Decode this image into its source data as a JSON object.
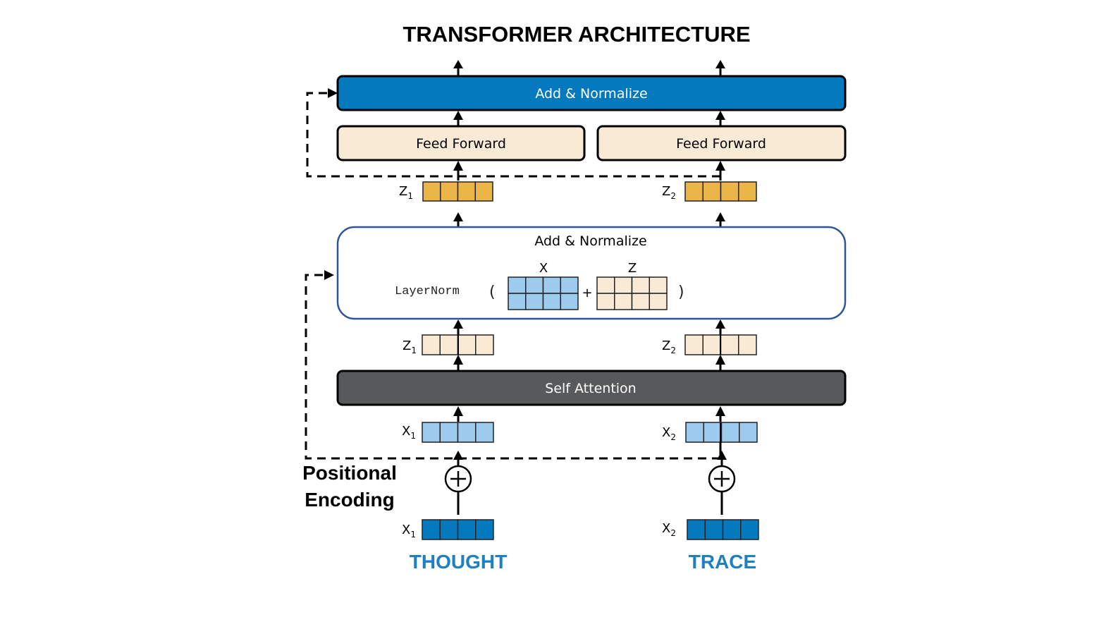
{
  "title": "TRANSFORMER ARCHITECTURE",
  "colors": {
    "add_norm_top_fill": "#0479bd",
    "feed_forward_fill": "#f9ead6",
    "self_attention_fill": "#58595b",
    "add_norm_mid_border": "#2f5597",
    "z_top_fill": "#ebb548",
    "z_mid_fill": "#f9ead6",
    "x_mid_fill": "#9dcbee",
    "x_input_fill": "#0479bd",
    "token_text": "#1e7fc1"
  },
  "blocks": {
    "add_normalize_top": "Add & Normalize",
    "feed_forward_left": "Feed Forward",
    "feed_forward_right": "Feed Forward",
    "add_normalize_mid": "Add & Normalize",
    "layernorm_fn": "LayerNorm",
    "paren_open": "(",
    "paren_close": ")",
    "plus": "+",
    "matrix_x_label": "X",
    "matrix_z_label": "Z",
    "self_attention": "Self Attention"
  },
  "vectors": {
    "z_top": [
      {
        "name": "Z",
        "sub": "1"
      },
      {
        "name": "Z",
        "sub": "2"
      }
    ],
    "z_mid": [
      {
        "name": "Z",
        "sub": "1"
      },
      {
        "name": "Z",
        "sub": "2"
      }
    ],
    "x_mid": [
      {
        "name": "X",
        "sub": "1"
      },
      {
        "name": "X",
        "sub": "2"
      }
    ],
    "x_input": [
      {
        "name": "X",
        "sub": "1"
      },
      {
        "name": "X",
        "sub": "2"
      }
    ]
  },
  "positional_encoding": [
    "Positional",
    "Encoding"
  ],
  "tokens": [
    "THOUGHT",
    "TRACE"
  ]
}
